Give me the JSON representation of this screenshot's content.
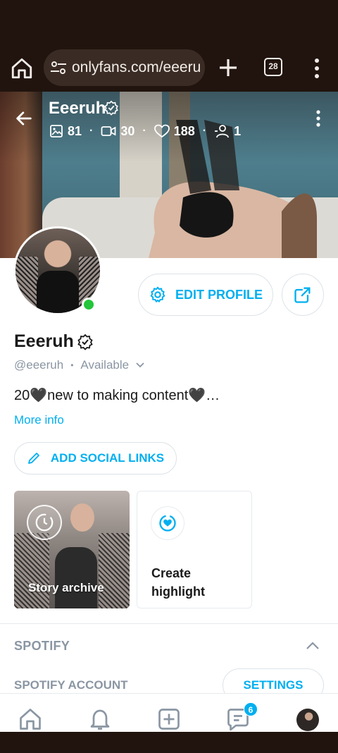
{
  "browser": {
    "url": "onlyfans.com/eeeru",
    "tab_count": "28",
    "icons": [
      "home-icon",
      "site-settings-icon",
      "new-tab-icon",
      "tab-switcher-icon",
      "overflow-menu-icon"
    ]
  },
  "profile": {
    "cover_name": "Eeeruh",
    "stats": {
      "photos": "81",
      "videos": "30",
      "likes": "188",
      "followers": "1"
    },
    "name": "Eeeruh",
    "handle": "@eeeruh",
    "status": "Available",
    "bio": "20🖤new to making content🖤…",
    "more_info": "More info",
    "online": true,
    "accent_color": "#00aff0",
    "online_color": "#23c53a"
  },
  "actions": {
    "edit_profile": "EDIT PROFILE",
    "add_social_links": "ADD SOCIAL LINKS"
  },
  "highlights": {
    "story_archive": "Story archive",
    "create_highlight": "Create highlight"
  },
  "spotify": {
    "title": "SPOTIFY",
    "account_label": "SPOTIFY ACCOUNT",
    "settings_button": "SETTINGS"
  },
  "bottom_nav": {
    "items": [
      "home",
      "notifications",
      "new-post",
      "messages",
      "profile"
    ],
    "messages_badge": "6"
  }
}
